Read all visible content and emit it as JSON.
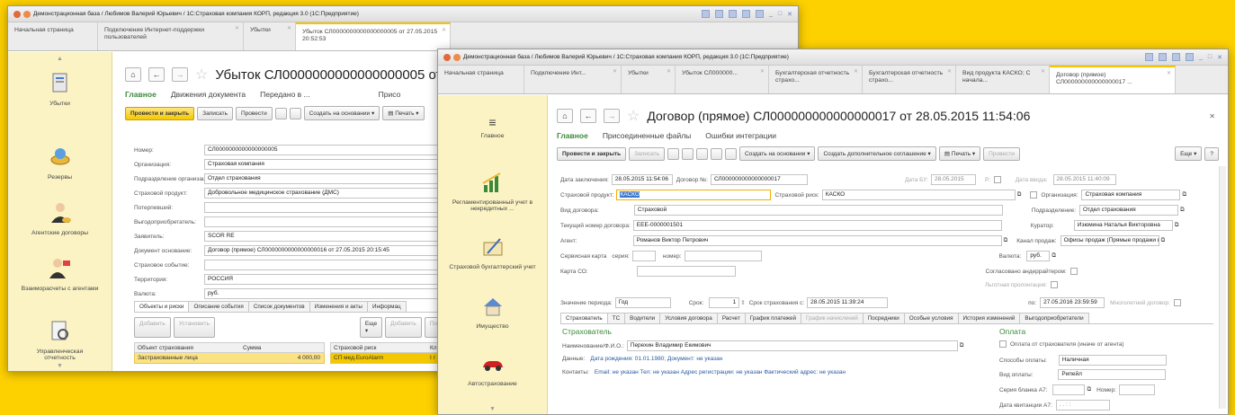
{
  "w1": {
    "title": "Демонстрационная база / Любимов Валерий Юрьевич / 1С:Страховая компания КОРП, редакция 3.0  (1С:Предприятие)",
    "tabs": [
      "Начальная страница",
      "Подключение Интернет-поддержки пользователей",
      "Убытки",
      "Убыток СЛ0000000000000000005 от 27.05.2015 20:52:53"
    ],
    "sections": [
      "Убытки",
      "Резервы",
      "Агентские договоры",
      "Взаиморасчеты с агентами",
      "Управленческая отчетность"
    ],
    "doc_title": "Убыток СЛ0000000000000000005 от 2",
    "subtabs": [
      "Главное",
      "Движения документа",
      "Передано в ...",
      "Присо"
    ],
    "buttons": {
      "post_close": "Провести и закрыть",
      "save": "Записать",
      "post": "Провести",
      "create_based": "Создать на основании",
      "print": "Печать"
    },
    "fields": [
      {
        "label": "Номер:",
        "value": "СЛ0000000000000000005"
      },
      {
        "label": "Организация:",
        "value": "Страховая компания"
      },
      {
        "label": "Подразделение организации:",
        "value": "Отдел страхования"
      },
      {
        "label": "Страховой продукт:",
        "value": "Добровольное медицинское страхование (ДМС)"
      },
      {
        "label": "Потерпевший:",
        "value": ""
      },
      {
        "label": "Выгодоприобретатель:",
        "value": ""
      },
      {
        "label": "Заявитель:",
        "value": "SCOR RE"
      },
      {
        "label": "Документ основание:",
        "value": "Договор (прямое) СЛ0000000000000000016 от 27.05.2015 20:15:45"
      },
      {
        "label": "Страховое событие:",
        "value": ""
      },
      {
        "label": "Территория:",
        "value": "РОССИЯ"
      },
      {
        "label": "Валюта:",
        "value": "руб."
      }
    ],
    "inner_tabs": [
      "Объекты и риски",
      "Описание события",
      "Список документов",
      "Изменения и акты",
      "Информац"
    ],
    "grid_buttons": {
      "add": "Добавить",
      "set": "Установить",
      "more": "Еще",
      "add2": "Добавить",
      "pick": "Подбор",
      "copy": "Скопир"
    },
    "grid1_head": [
      "Объект страхования",
      "Сумма"
    ],
    "grid1_row": [
      "Застрахованные лица",
      "4 000,00"
    ],
    "grid2_head": [
      "Страховой риск",
      "Кл"
    ],
    "grid2_row": [
      "СП мед.EuroAlarm",
      "I г"
    ]
  },
  "w2": {
    "title": "Демонстрационная база / Любимов Валерий Юрьевич / 1С:Страховая компания КОРП, редакция 3.0  (1С:Предприятие)",
    "tabs": [
      "Начальная страница",
      "Подключение Инт...",
      "Убытки",
      "Убыток СЛ000000...",
      "Бухгалтерская отчетность страхо...",
      "Бухгалтерская отчетность страхо...",
      "Вид продукта КАСКО; С начала...",
      "Договор (прямое) СЛ000000000000000017 ..."
    ],
    "sections": [
      "Главное",
      "Регламентированный учет в некредитных ...",
      "Страховой бухгалтерский учет",
      "Имущество",
      "Автострахование"
    ],
    "doc_title": "Договор (прямое) СЛ000000000000000017 от 28.05.2015 11:54:06",
    "subtabs": [
      "Главное",
      "Присоединенные файлы",
      "Ошибки интеграции"
    ],
    "buttons": {
      "post_close": "Провести и закрыть",
      "save": "Записать",
      "create_based": "Создать на основании",
      "create_add": "Создать дополнительное соглашение",
      "print": "Печать",
      "post": "Провести",
      "more": "Еще",
      "help": "?"
    },
    "date_conclusion_label": "Дата заключения:",
    "date_conclusion": "28.05.2015 11:54:06",
    "contract_no_label": "Договор №:",
    "contract_no": "СЛ000000000000000017",
    "date_bu_label": "Дата БУ:",
    "date_bu": "28.05.2015",
    "r_label": "Р.:",
    "date_input_label": "Дата ввода:",
    "date_input": "28.05.2015 11:40:09",
    "product_label": "Страховой продукт:",
    "product": "КАСКО",
    "risk_label": "Страховой риск:",
    "risk": "КАСКО",
    "org_label": "Организация:",
    "org": "Страховая компания",
    "kind_label": "Вид договора:",
    "kind": "Страховой",
    "dept_label": "Подразделение:",
    "dept": "Отдел страхования",
    "current_no_label": "Текущий номер договора:",
    "current_no": "EEE-0000001501",
    "curator_label": "Куратор:",
    "curator": "Изюмина Наталья Викторовна",
    "agent_label": "Агент:",
    "agent": "Романов Виктор Петрович",
    "channel_label": "Канал продаж:",
    "channel": "Офисы продаж (Прямые продажи в",
    "service_label": "Сервисная карта",
    "series_label": "серия:",
    "number_label": "номер:",
    "currency_label": "Валюта:",
    "currency": "руб.",
    "card_label": "Карта СО:",
    "agreed_label": "Согласовано андеррайтером:",
    "pref_label": "Льготная пролонгация:",
    "period_label": "Значение периода:",
    "period": "Год",
    "term_label": "Срок:",
    "term": "1",
    "ins_term_label": "Срок страхования с:",
    "ins_from": "28.05.2015 11:39:24",
    "to_label": "по:",
    "ins_to": "27.05.2016 23:59:59",
    "multiyear_label": "Многолетний договор:",
    "inner_tabs": [
      "Страхователь",
      "ТС",
      "Водители",
      "Условия договора",
      "Расчет",
      "График платежей",
      "График начислений",
      "Посредники",
      "Особые условия",
      "История изменений",
      "Выгодоприобретатели"
    ],
    "insurer_title": "Страхователь",
    "name_label": "Наименование/Ф.И.О.:",
    "name": "Перехин Владимир Екимович",
    "data_label": "Данные:",
    "data": "Дата рождения: 01.01.1980; Документ: не указан",
    "contacts_label": "Контакты:",
    "contacts": "Email: не указан Тел: не указан Адрес регистрации: не указан Фактический адрес: не указан",
    "payment_title": "Оплата",
    "pay_from_label": "Оплата от страхователя (иначе от агента)",
    "pay_ways_label": "Способы оплаты:",
    "pay_ways": "Наличная",
    "pay_kind_label": "Вид оплаты:",
    "pay_kind": "Рипейл",
    "a7_series_label": "Серия бланка А7:",
    "a7_number_label": "Номер:",
    "receipt_date_label": "Дата квитанции А7:",
    "receipt_date": ". .   : :"
  }
}
